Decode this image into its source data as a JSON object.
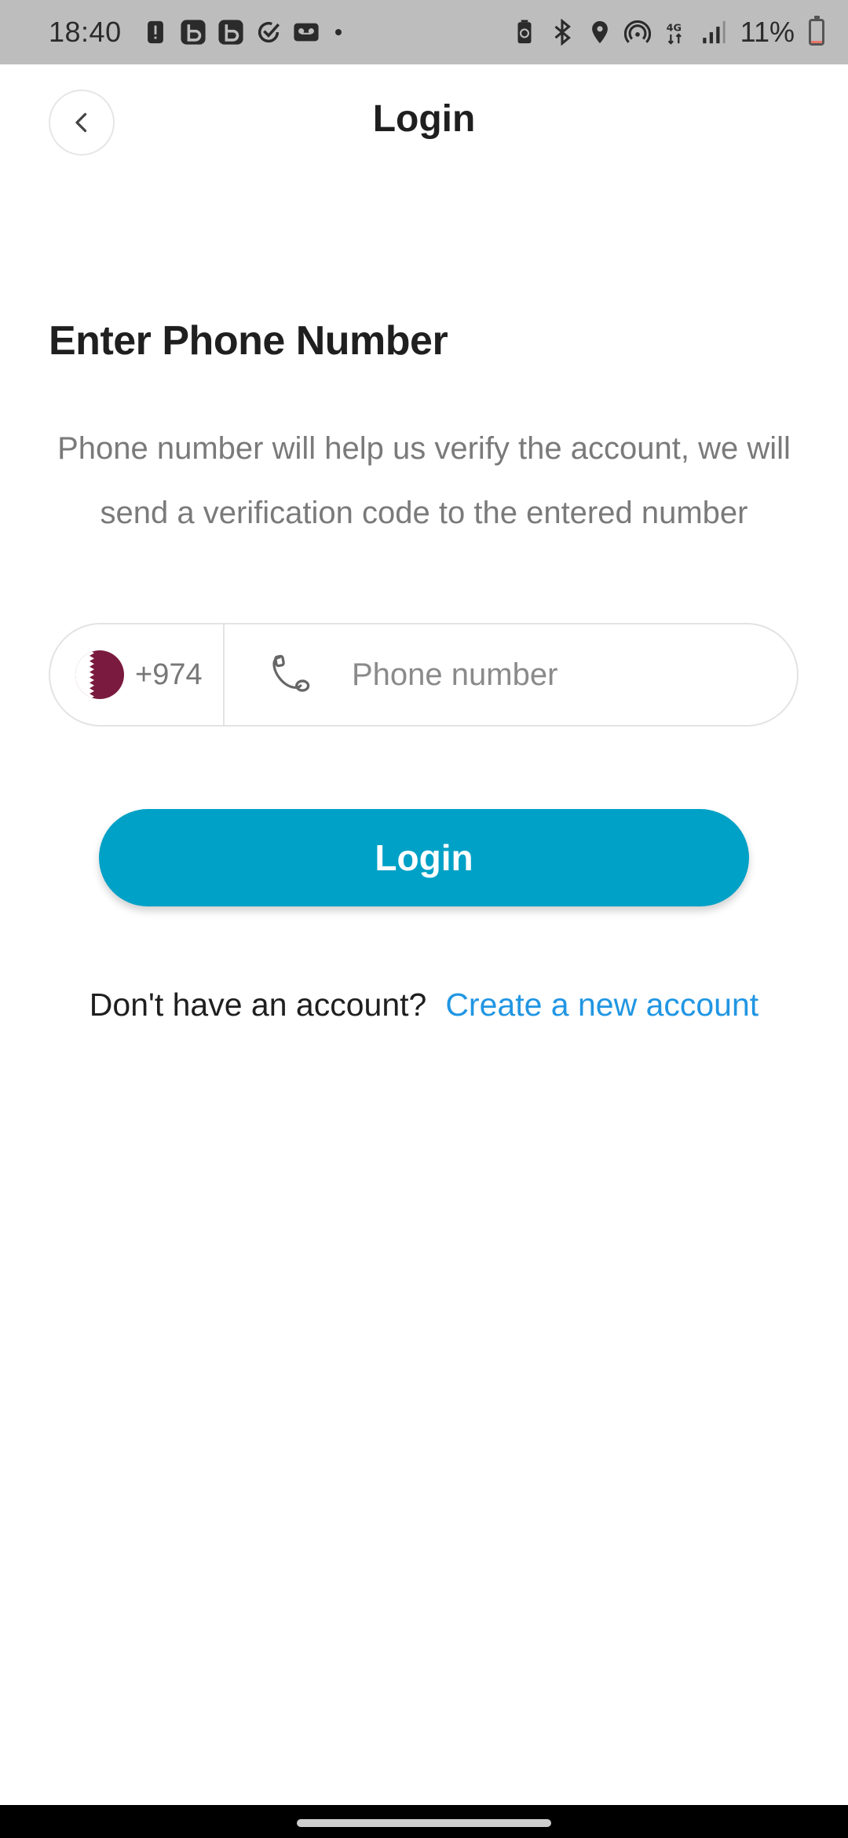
{
  "status_bar": {
    "time": "18:40",
    "battery_percent": "11%",
    "battery_level": 0.11,
    "notification_icons": [
      "alert-icon",
      "b-app-icon",
      "b-app-icon",
      "check-circle-icon",
      "voicemail-icon"
    ],
    "system_icons": [
      "battery-saver-icon",
      "bluetooth-icon",
      "location-icon",
      "hotspot-icon",
      "network-4g-icon",
      "signal-icon"
    ]
  },
  "header": {
    "back_icon": "chevron-left-icon",
    "title": "Login"
  },
  "main": {
    "heading": "Enter Phone Number",
    "description": "Phone number will help us verify the account, we will send a verification code to the entered number",
    "phone_field": {
      "country_flag": "qatar-flag",
      "dial_code": "+974",
      "icon": "phone-icon",
      "placeholder": "Phone number",
      "value": ""
    },
    "login_button_label": "Login",
    "signup_prompt": "Don't have an account?",
    "signup_link": "Create a new account"
  },
  "colors": {
    "accent": "#00a1c7",
    "link": "#2196e3",
    "flag_maroon": "#7a1a3e"
  }
}
